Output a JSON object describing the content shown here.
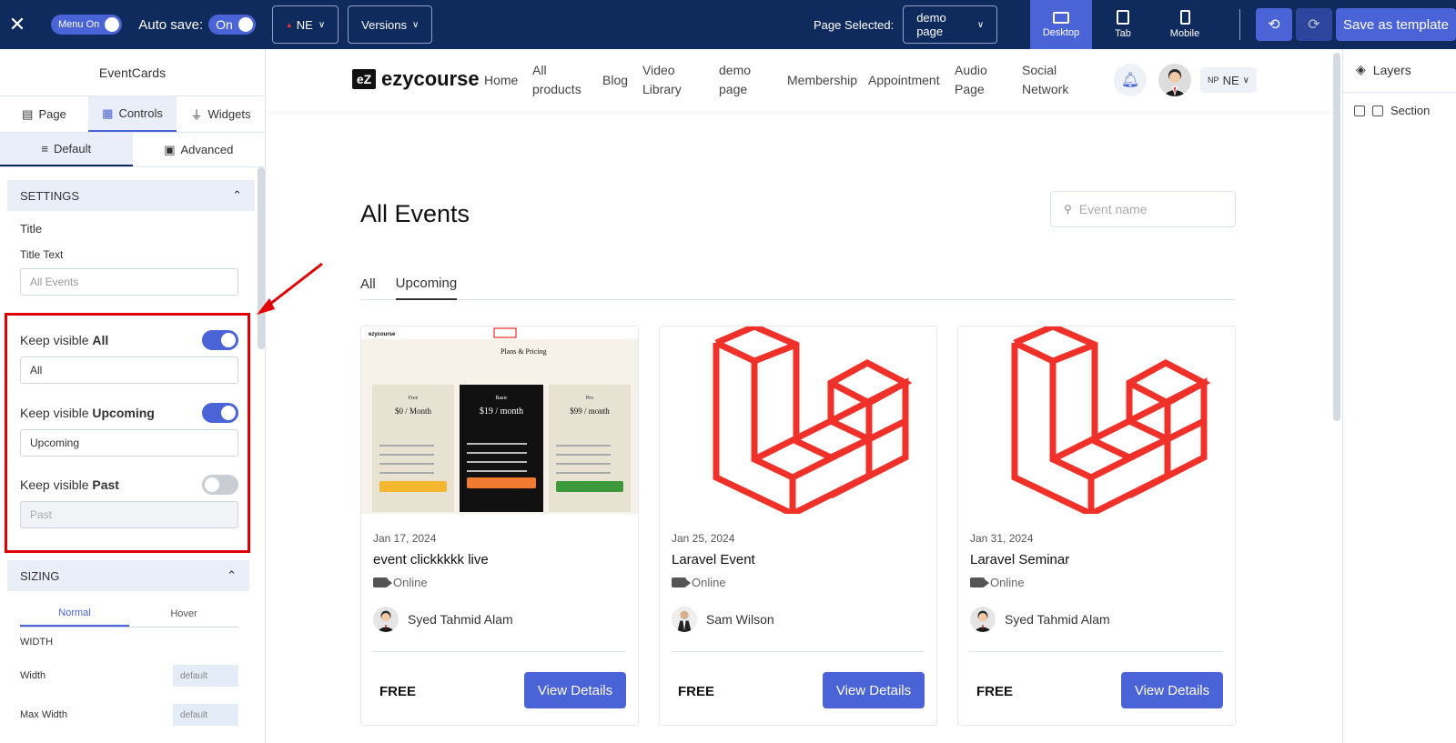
{
  "topbar": {
    "menu_toggle_label": "Menu On",
    "autosave_label": "Auto save:",
    "autosave_value": "On",
    "language_label": "NE",
    "versions_label": "Versions",
    "page_selected_label": "Page Selected:",
    "page_selected_value": "demo page",
    "devices": [
      {
        "label": "Desktop",
        "active": true
      },
      {
        "label": "Tab",
        "active": false
      },
      {
        "label": "Mobile",
        "active": false
      }
    ],
    "save_template_label": "Save as template"
  },
  "left_panel": {
    "title": "EventCards",
    "tabs": [
      "Page",
      "Controls",
      "Widgets"
    ],
    "active_tab": "Controls",
    "subtabs": [
      "Default",
      "Advanced"
    ],
    "settings_header": "SETTINGS",
    "title_label": "Title",
    "title_text_label": "Title Text",
    "title_text_placeholder": "All Events",
    "keep_visible_prefix": "Keep visible",
    "keep_all_label": "All",
    "keep_all_value": "All",
    "keep_all_on": true,
    "keep_upcoming_label": "Upcoming",
    "keep_upcoming_value": "Upcoming",
    "keep_upcoming_on": true,
    "keep_past_label": "Past",
    "keep_past_value": "Past",
    "keep_past_on": false,
    "sizing_header": "SIZING",
    "sizing_tabs": [
      "Normal",
      "Hover"
    ],
    "width_header": "WIDTH",
    "width_label": "Width",
    "width_value": "default",
    "max_width_label": "Max Width",
    "max_width_value": "default"
  },
  "site": {
    "brand": "ezycourse",
    "nav": [
      "Home",
      "All products",
      "Blog",
      "Video Library",
      "demo page",
      "Membership",
      "Appointment",
      "Audio Page",
      "Social Network"
    ],
    "lang_prefix": "NP",
    "lang": "NE",
    "events_title": "All Events",
    "search_placeholder": "Event name",
    "event_tabs": [
      "All",
      "Upcoming"
    ],
    "active_event_tab": "Upcoming",
    "cards": [
      {
        "date": "Jan 17, 2024",
        "title": "event clickkkkk live",
        "mode": "Online",
        "author": "Syed Tahmid Alam",
        "price": "FREE",
        "button": "View Details",
        "image": "pricing-screenshot"
      },
      {
        "date": "Jan 25, 2024",
        "title": "Laravel Event",
        "mode": "Online",
        "author": "Sam Wilson",
        "price": "FREE",
        "button": "View Details",
        "image": "laravel-logo"
      },
      {
        "date": "Jan 31, 2024",
        "title": "Laravel Seminar",
        "mode": "Online",
        "author": "Syed Tahmid Alam",
        "price": "FREE",
        "button": "View Details",
        "image": "laravel-logo"
      }
    ],
    "pricing_thumb": {
      "heading": "Plans & Pricing",
      "plans": [
        {
          "name": "Free",
          "price": "$0 / Month",
          "button_color": "#f5b630"
        },
        {
          "name": "Basic",
          "price": "$19 / month",
          "button_color": "#f07a30"
        },
        {
          "name": "Pro",
          "price": "$99 / month",
          "button_color": "#3c9a3c"
        }
      ]
    }
  },
  "right_panel": {
    "layers_label": "Layers",
    "section_label": "Section"
  },
  "colors": {
    "topbar": "#0f2a5c",
    "accent": "#4a64d8",
    "highlight": "#e00000",
    "laravel": "#f0312a"
  }
}
